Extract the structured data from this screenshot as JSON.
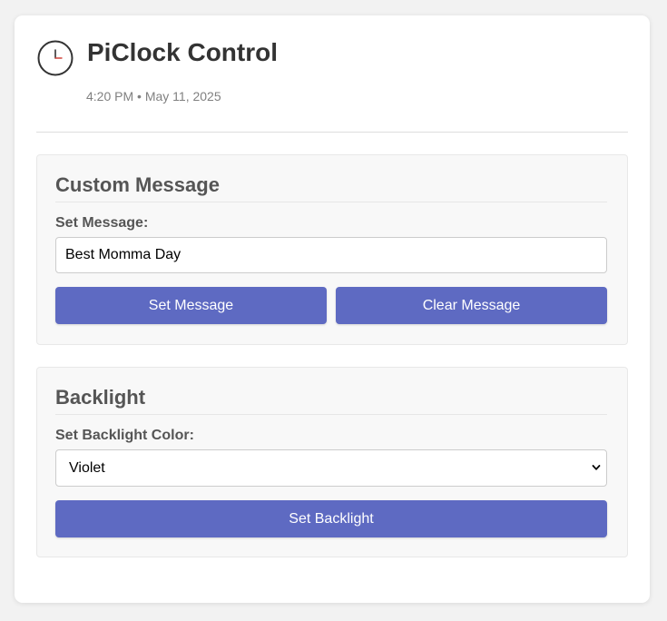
{
  "header": {
    "icon": "clock-icon",
    "title": "PiClock Control",
    "datetime": "4:20 PM • May 11, 2025"
  },
  "message_section": {
    "title": "Custom Message",
    "field_label": "Set Message:",
    "input_value": "Best Momma Day",
    "set_button": "Set Message",
    "clear_button": "Clear Message"
  },
  "backlight_section": {
    "title": "Backlight",
    "field_label": "Set Backlight Color:",
    "selected_color": "Violet",
    "set_button": "Set Backlight"
  },
  "colors": {
    "accent": "#5e6ac2",
    "background": "#f2f2f2",
    "card": "#ffffff",
    "section": "#f8f8f8"
  }
}
